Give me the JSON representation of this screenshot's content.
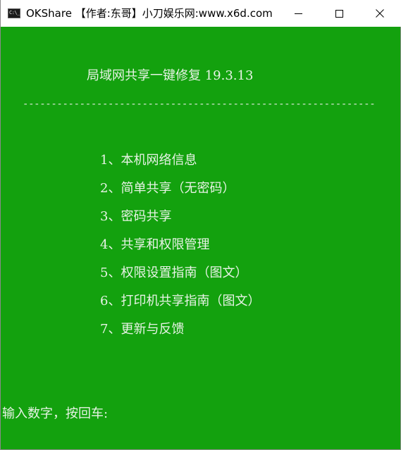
{
  "window": {
    "title": "OKShare 【作者:东哥】小刀娱乐网:www.x6d.com",
    "icon_text": "C:\\_",
    "icon_name": "console-app-icon",
    "background_color": "#13a10e",
    "text_color": "#e8f3e6"
  },
  "controls": {
    "minimize_icon": "minimize-icon",
    "maximize_icon": "maximize-icon",
    "close_icon": "close-icon"
  },
  "console": {
    "heading": "局域网共享一键修复 19.3.13",
    "divider": "--------------------------------------------------------------",
    "menu": [
      "1、本机网络信息",
      "2、简单共享（无密码）",
      "3、密码共享",
      "4、共享和权限管理",
      "5、权限设置指南（图文）",
      "6、打印机共享指南（图文）",
      "7、更新与反馈"
    ],
    "prompt": "输入数字，按回车:"
  }
}
